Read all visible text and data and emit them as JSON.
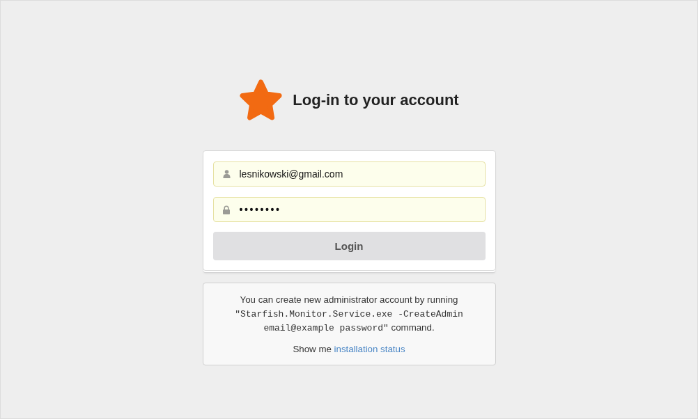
{
  "header": {
    "title": "Log-in to your account"
  },
  "login_form": {
    "fields": [
      {
        "kind": "email",
        "value": "lesnikowski@gmail.com"
      },
      {
        "kind": "password",
        "value": "••••••••"
      }
    ],
    "submit_button": "Login"
  },
  "message": {
    "paragraph": [
      {
        "kind": "text",
        "text": "You can create new administrator account by running "
      },
      {
        "kind": "code",
        "text": "\"Starfish.Monitor.Service.exe -CreateAdmin email@example password\""
      },
      {
        "kind": "text",
        "text": " command."
      }
    ],
    "status_prompt": {
      "text": "Show me ",
      "link": "installation status"
    }
  }
}
